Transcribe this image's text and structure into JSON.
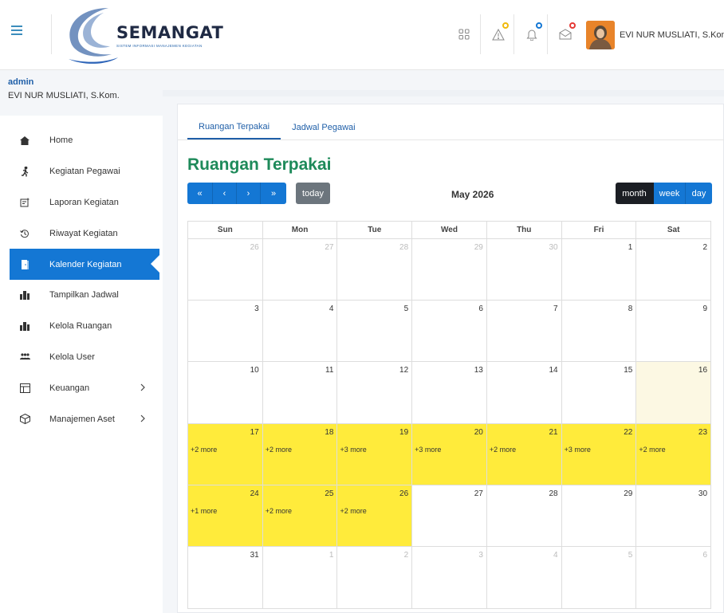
{
  "header": {
    "logo_text": "SEMANGAT",
    "logo_subtitle": "SISTEM INFORMASI MANAJEMEN KEGIATAN",
    "user_name": "EVI NUR MUSLIATI, S.Kom."
  },
  "sidebar": {
    "role": "admin",
    "user_name": "EVI NUR MUSLIATI, S.Kom.",
    "items": [
      {
        "label": "Home",
        "icon": "home-icon"
      },
      {
        "label": "Kegiatan Pegawai",
        "icon": "running-person-icon"
      },
      {
        "label": "Laporan Kegiatan",
        "icon": "report-icon"
      },
      {
        "label": "Riwayat Kegiatan",
        "icon": "history-icon"
      },
      {
        "label": "Kalender Kegiatan",
        "icon": "door-icon",
        "active": true
      },
      {
        "label": "Tampilkan Jadwal",
        "icon": "building-icon"
      },
      {
        "label": "Kelola Ruangan",
        "icon": "building-icon"
      },
      {
        "label": "Kelola User",
        "icon": "users-icon"
      },
      {
        "label": "Keuangan",
        "icon": "table-icon",
        "has_submenu": true
      },
      {
        "label": "Manajemen Aset",
        "icon": "box-icon",
        "has_submenu": true
      }
    ]
  },
  "tabs": [
    {
      "label": "Ruangan Terpakai",
      "active": true
    },
    {
      "label": "Jadwal Pegawai",
      "active": false
    }
  ],
  "calendar": {
    "title": "Ruangan Terpakai",
    "month_label": "May 2026",
    "nav_buttons": [
      "«",
      "‹",
      "›",
      "»"
    ],
    "today_label": "today",
    "views": [
      {
        "label": "month",
        "active": true
      },
      {
        "label": "week",
        "active": false
      },
      {
        "label": "day",
        "active": false
      }
    ],
    "weekdays": [
      "Sun",
      "Mon",
      "Tue",
      "Wed",
      "Thu",
      "Fri",
      "Sat"
    ],
    "weeks": [
      [
        {
          "d": "26",
          "o": true
        },
        {
          "d": "27",
          "o": true
        },
        {
          "d": "28",
          "o": true
        },
        {
          "d": "29",
          "o": true
        },
        {
          "d": "30",
          "o": true
        },
        {
          "d": "1"
        },
        {
          "d": "2"
        }
      ],
      [
        {
          "d": "3"
        },
        {
          "d": "4"
        },
        {
          "d": "5"
        },
        {
          "d": "6"
        },
        {
          "d": "7"
        },
        {
          "d": "8"
        },
        {
          "d": "9"
        }
      ],
      [
        {
          "d": "10"
        },
        {
          "d": "11"
        },
        {
          "d": "12"
        },
        {
          "d": "13"
        },
        {
          "d": "14"
        },
        {
          "d": "15"
        },
        {
          "d": "16",
          "today": true
        }
      ],
      [
        {
          "d": "17",
          "more": "+2 more"
        },
        {
          "d": "18",
          "more": "+2 more"
        },
        {
          "d": "19",
          "more": "+3 more"
        },
        {
          "d": "20",
          "more": "+3 more"
        },
        {
          "d": "21",
          "more": "+2 more"
        },
        {
          "d": "22",
          "more": "+3 more"
        },
        {
          "d": "23",
          "more": "+2 more"
        }
      ],
      [
        {
          "d": "24",
          "more": "+1 more"
        },
        {
          "d": "25",
          "more": "+2 more"
        },
        {
          "d": "26",
          "more": "+2 more"
        },
        {
          "d": "27"
        },
        {
          "d": "28"
        },
        {
          "d": "29"
        },
        {
          "d": "30"
        }
      ],
      [
        {
          "d": "31"
        },
        {
          "d": "1",
          "o": true
        },
        {
          "d": "2",
          "o": true
        },
        {
          "d": "3",
          "o": true
        },
        {
          "d": "4",
          "o": true
        },
        {
          "d": "5",
          "o": true
        },
        {
          "d": "6",
          "o": true
        }
      ]
    ]
  },
  "colors": {
    "primary": "#1477d4",
    "title_green": "#1e8a5a",
    "event_yellow": "#ffeb3b",
    "today_bg": "#fcf8e3"
  }
}
